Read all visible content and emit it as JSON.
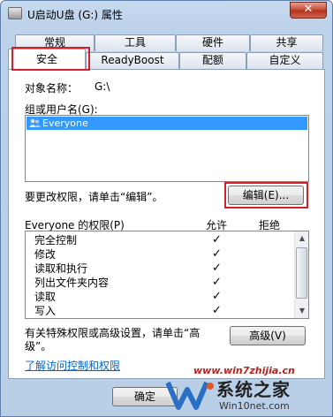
{
  "window": {
    "title": "U启动U盘 (G:) 属性",
    "close_symbol": "✕"
  },
  "tabs": {
    "row_back": [
      "常规",
      "工具",
      "硬件",
      "共享"
    ],
    "row_front": [
      "安全",
      "ReadyBoost",
      "配额",
      "自定义"
    ],
    "active": "安全"
  },
  "security": {
    "object_name_label": "对象名称：",
    "object_name_value": "G:\\",
    "group_label": "组或用户名(G):",
    "users": [
      "Everyone"
    ],
    "edit_prompt": "要更改权限，请单击“编辑”。",
    "edit_button": "编辑(E)...",
    "perm_header": "Everyone 的权限(P)",
    "allow_header": "允许",
    "deny_header": "拒绝",
    "permissions": [
      "完全控制",
      "修改",
      "读取和执行",
      "列出文件夹内容",
      "读取",
      "写入"
    ],
    "allow_mark": "✓",
    "special_text_line1": "有关特殊权限或高级设置，请单击“高",
    "special_text_line2": "级”。",
    "advanced_button": "高级(V)",
    "learn_link": "了解访问控制和权限"
  },
  "footer": {
    "ok_button": "确定"
  },
  "watermark": {
    "site": "www.win7zhijia.cn",
    "brand": "系统之家",
    "domain": "Win10net.com"
  },
  "colors": {
    "selection": "#3399ff",
    "highlight_box": "#d3202b",
    "watermark": "#d3202b"
  }
}
